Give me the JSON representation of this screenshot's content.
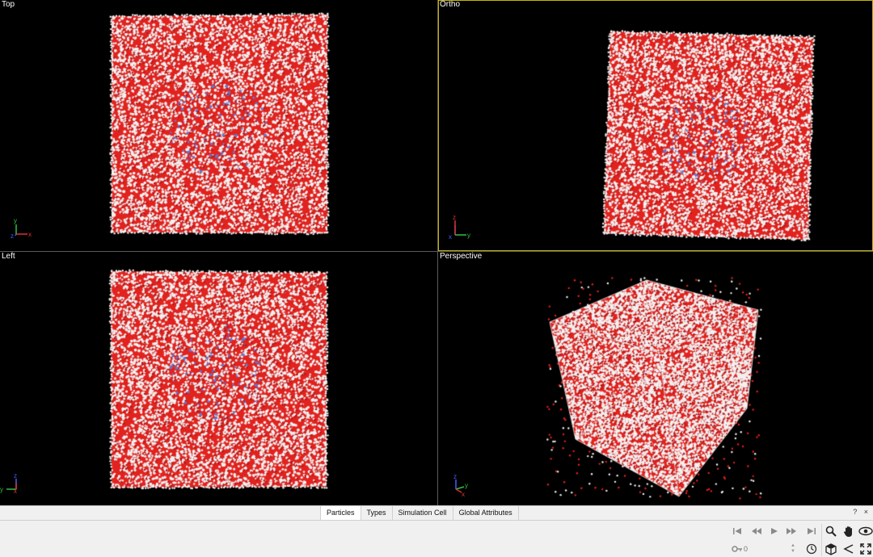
{
  "viewports": {
    "top": {
      "caption": "Top",
      "axes": {
        "up": "y",
        "right": "x",
        "out": "z"
      }
    },
    "ortho": {
      "caption": "Ortho",
      "axes": {
        "up": "z",
        "right": "y",
        "out": "x"
      }
    },
    "left": {
      "caption": "Left",
      "axes": {
        "up": "z",
        "right": "x",
        "out": "y"
      }
    },
    "perspective": {
      "caption": "Perspective",
      "axes": {
        "up": "z",
        "right": "y",
        "out": "x"
      }
    }
  },
  "colors": {
    "viewport_bg": "#000000",
    "active_border": "#c8b400",
    "oxygen": "#e2221e",
    "hydrogen": "#f2f2f2",
    "solute": "#5a7bd8",
    "cell_edge": "#e8e8e8",
    "axis_x": "#e03030",
    "axis_y": "#30c040",
    "axis_z": "#4060ff"
  },
  "data_inspector": {
    "tabs": [
      "Particles",
      "Types",
      "Simulation Cell",
      "Global Attributes"
    ],
    "active_tab": "Particles",
    "help_glyph": "?",
    "close_glyph": "×"
  },
  "animation": {
    "frame_value": "0",
    "buttons": [
      "jump-start",
      "step-back",
      "play",
      "step-forward",
      "jump-end"
    ]
  },
  "nav_tools": [
    "zoom",
    "pan",
    "orbit",
    "fov",
    "pick-orbit-center",
    "maximize"
  ]
}
